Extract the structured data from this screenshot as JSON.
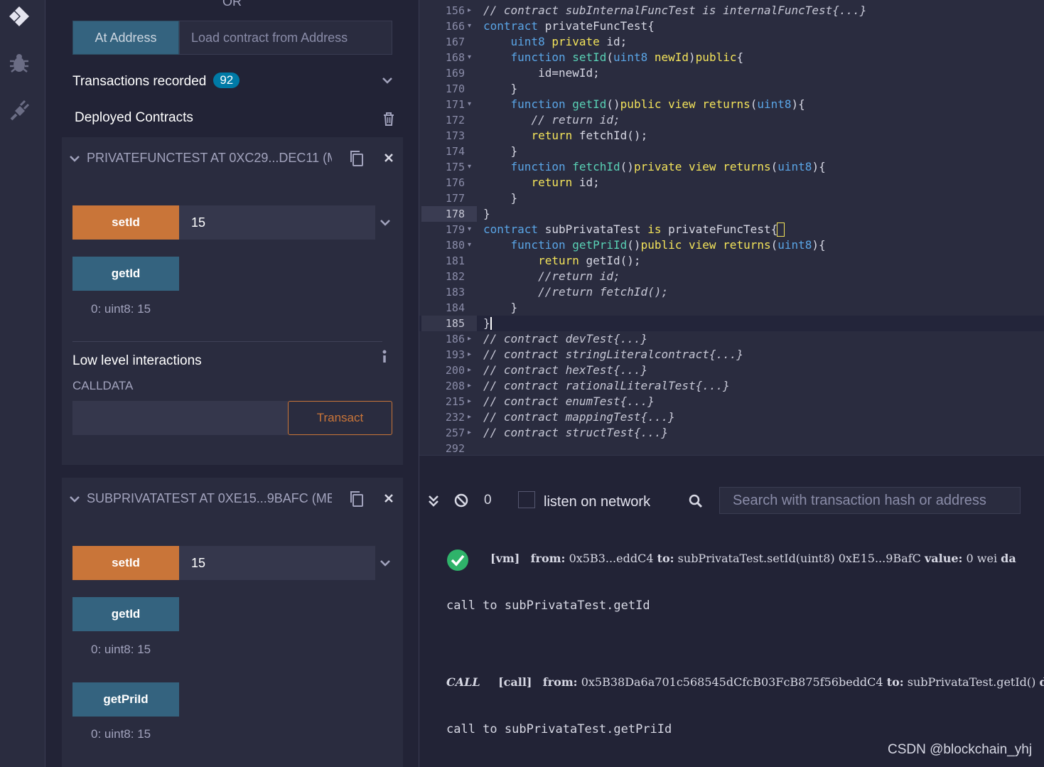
{
  "rail": {
    "icons": [
      "remix-logo-icon",
      "debugger-icon",
      "plugin-manager-icon"
    ]
  },
  "panel": {
    "or_label": "OR",
    "at_address_label": "At Address",
    "at_address_placeholder": "Load contract from Address",
    "transactions_label": "Transactions recorded",
    "transactions_count": "92",
    "deployed_label": "Deployed Contracts",
    "contracts": [
      {
        "title": "PRIVATEFUNCTEST AT 0XC29...DEC11 (M",
        "functions": [
          {
            "label": "setId",
            "kind": "transact",
            "value": "15"
          },
          {
            "label": "getId",
            "kind": "call",
            "output": "0: uint8: 15"
          }
        ],
        "low_level": {
          "title": "Low level interactions",
          "calldata_label": "CALLDATA",
          "transact_label": "Transact"
        }
      },
      {
        "title": "SUBPRIVATATEST AT 0XE15...9BAFC (ME",
        "functions": [
          {
            "label": "setId",
            "kind": "transact",
            "value": "15"
          },
          {
            "label": "getId",
            "kind": "call",
            "output": "0: uint8: 15"
          },
          {
            "label": "getPriId",
            "kind": "call",
            "output": "0: uint8: 15"
          }
        ]
      }
    ]
  },
  "editor": {
    "lines": [
      {
        "n": "156",
        "fold": "▸",
        "html": "<span class=\"cm\">// contract subInternalFuncTest is internalFuncTest{...}</span>"
      },
      {
        "n": "166",
        "fold": "▾",
        "html": "<span class=\"kw\">contract</span> privateFuncTest{"
      },
      {
        "n": "167",
        "fold": "",
        "html": "    <span class=\"ty\">uint8</span> <span class=\"mod\">private</span> id;"
      },
      {
        "n": "168",
        "fold": "▾",
        "html": "    <span class=\"kw\">function</span> <span class=\"fnn\">setId</span>(<span class=\"ty\">uint8</span> <span class=\"mod\">newId</span>)<span class=\"mod\">public</span>{"
      },
      {
        "n": "169",
        "fold": "",
        "html": "        id=newId;"
      },
      {
        "n": "170",
        "fold": "",
        "html": "    }"
      },
      {
        "n": "171",
        "fold": "▾",
        "html": "    <span class=\"kw\">function</span> <span class=\"fnn\">getId</span>()<span class=\"mod\">public</span> <span class=\"mod\">view</span> <span class=\"mod\">returns</span>(<span class=\"ty\">uint8</span>){"
      },
      {
        "n": "172",
        "fold": "",
        "html": "       <span class=\"cm\">// return id;</span>"
      },
      {
        "n": "173",
        "fold": "",
        "html": "       <span class=\"mod\">return</span> fetchId();"
      },
      {
        "n": "174",
        "fold": "",
        "html": "    }"
      },
      {
        "n": "175",
        "fold": "▾",
        "html": "    <span class=\"kw\">function</span> <span class=\"fnn\">fetchId</span>()<span class=\"mod\">private</span> <span class=\"mod\">view</span> <span class=\"mod\">returns</span>(<span class=\"ty\">uint8</span>){"
      },
      {
        "n": "176",
        "fold": "",
        "html": "       <span class=\"mod\">return</span> id;"
      },
      {
        "n": "177",
        "fold": "",
        "html": "    }"
      },
      {
        "n": "178",
        "fold": "",
        "html": "}"
      },
      {
        "n": "179",
        "fold": "▾",
        "html": "<span class=\"kw\">contract</span> subPrivataTest <span class=\"mod\">is</span> privateFuncTest{"
      },
      {
        "n": "180",
        "fold": "▾",
        "html": "    <span class=\"kw\">function</span> <span class=\"fnn\">getPriId</span>()<span class=\"mod\">public</span> <span class=\"mod\">view</span> <span class=\"mod\">returns</span>(<span class=\"ty\">uint8</span>){"
      },
      {
        "n": "181",
        "fold": "",
        "html": "        <span class=\"mod\">return</span> getId();"
      },
      {
        "n": "182",
        "fold": "",
        "html": "        <span class=\"cm\">//return id;</span>"
      },
      {
        "n": "183",
        "fold": "",
        "html": "        <span class=\"cm\">//return fetchId();</span>"
      },
      {
        "n": "184",
        "fold": "",
        "html": "    }"
      },
      {
        "n": "185",
        "fold": "",
        "html": "}"
      },
      {
        "n": "186",
        "fold": "▸",
        "html": "<span class=\"cm\">// contract devTest{...}</span>"
      },
      {
        "n": "193",
        "fold": "▸",
        "html": "<span class=\"cm\">// contract stringLiteralcontract{...}</span>"
      },
      {
        "n": "200",
        "fold": "▸",
        "html": "<span class=\"cm\">// contract hexTest{...}</span>"
      },
      {
        "n": "208",
        "fold": "▸",
        "html": "<span class=\"cm\">// contract rationalLiteralTest{...}</span>"
      },
      {
        "n": "215",
        "fold": "▸",
        "html": "<span class=\"cm\">// contract enumTest{...}</span>"
      },
      {
        "n": "232",
        "fold": "▸",
        "html": "<span class=\"cm\">// contract mappingTest{...}</span>"
      },
      {
        "n": "257",
        "fold": "▸",
        "html": "<span class=\"cm\">// contract structTest{...}</span>"
      },
      {
        "n": "292",
        "fold": "",
        "html": ""
      }
    ]
  },
  "terminal": {
    "count": "0",
    "listen_label": "listen on network",
    "search_placeholder": "Search with transaction hash or address",
    "tx1": {
      "tag": "[vm]",
      "from_label": "from:",
      "from": "0x5B3...eddC4",
      "to_label": "to:",
      "to": "subPrivataTest.setId(uint8) 0xE15...9BafC",
      "value_label": "value:",
      "value": "0 wei",
      "trail": "da"
    },
    "call1": "call to subPrivataTest.getId",
    "tx2": {
      "kind": "CALL",
      "tag": "[call]",
      "from_label": "from:",
      "from": "0x5B38Da6a701c568545dCfcB03FcB875f56beddC4",
      "to_label": "to:",
      "to": "subPrivataTest.getId()",
      "trail": "da"
    },
    "call2": "call to subPrivataTest.getPriId"
  },
  "watermark": "CSDN @blockchain_yhj"
}
